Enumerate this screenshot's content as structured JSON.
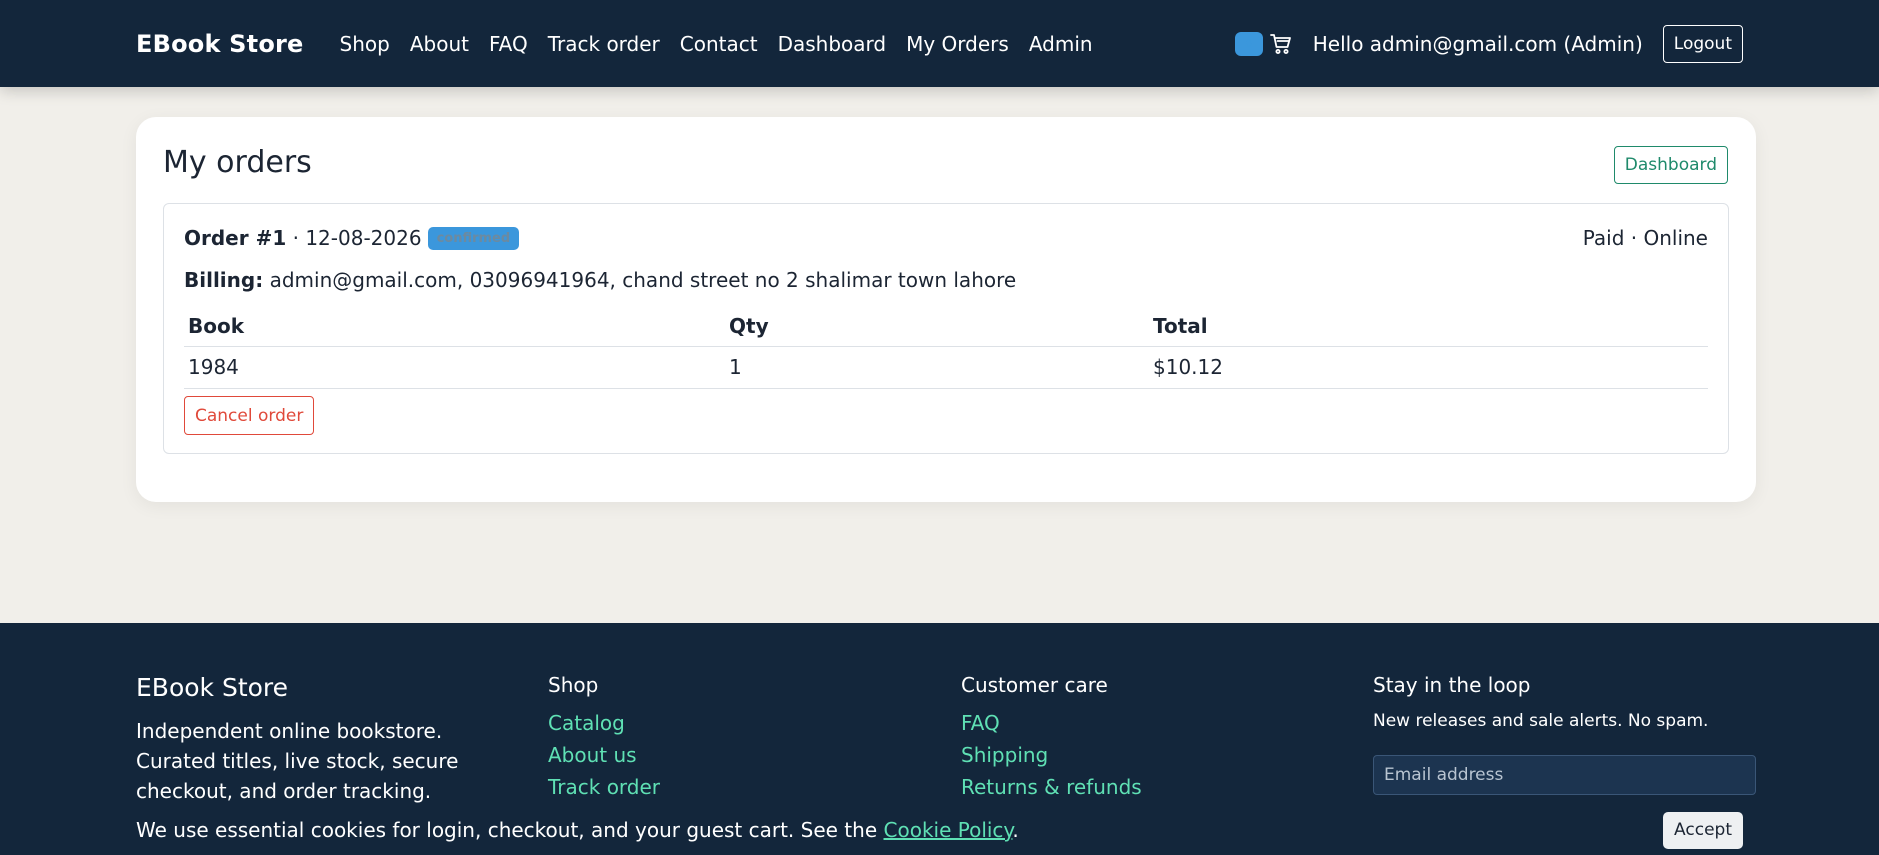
{
  "nav": {
    "brand": "EBook Store",
    "links": [
      "Shop",
      "About",
      "FAQ",
      "Track order",
      "Contact",
      "Dashboard",
      "My Orders",
      "Admin"
    ],
    "cart_count": "0",
    "greeting": "Hello admin@gmail.com (Admin)",
    "logout_label": "Logout"
  },
  "main": {
    "title": "My orders",
    "dashboard_label": "Dashboard",
    "order": {
      "number_label": "Order #1",
      "date": " · 12-08-2026",
      "status": "confirmed",
      "payment": "Paid · Online",
      "billing_label": "Billing:",
      "billing_value": " admin@gmail.com, 03096941964, chand street no 2 shalimar town lahore",
      "columns": [
        "Book",
        "Qty",
        "Total"
      ],
      "rows": [
        {
          "book": "1984",
          "qty": "1",
          "total": "$10.12"
        }
      ],
      "cancel_label": "Cancel order"
    }
  },
  "footer": {
    "brand": "EBook Store",
    "about": "Independent online bookstore. Curated titles, live stock, secure checkout, and order tracking.",
    "shop": {
      "heading": "Shop",
      "links": [
        "Catalog",
        "About us",
        "Track order"
      ]
    },
    "care": {
      "heading": "Customer care",
      "links": [
        "FAQ",
        "Shipping",
        "Returns & refunds"
      ]
    },
    "newsletter": {
      "heading": "Stay in the loop",
      "subtitle": "New releases and sale alerts. No spam.",
      "placeholder": "Email address"
    }
  },
  "cookie": {
    "text": "We use essential cookies for login, checkout, and your guest cart. See the ",
    "link": "Cookie Policy",
    "suffix": ".",
    "accept_label": "Accept"
  },
  "colors": {
    "navy": "#13263b",
    "accent_green": "#5fe0b4",
    "badge_blue": "#3b97dc",
    "danger": "#e0493a",
    "success": "#1f8a6b"
  }
}
